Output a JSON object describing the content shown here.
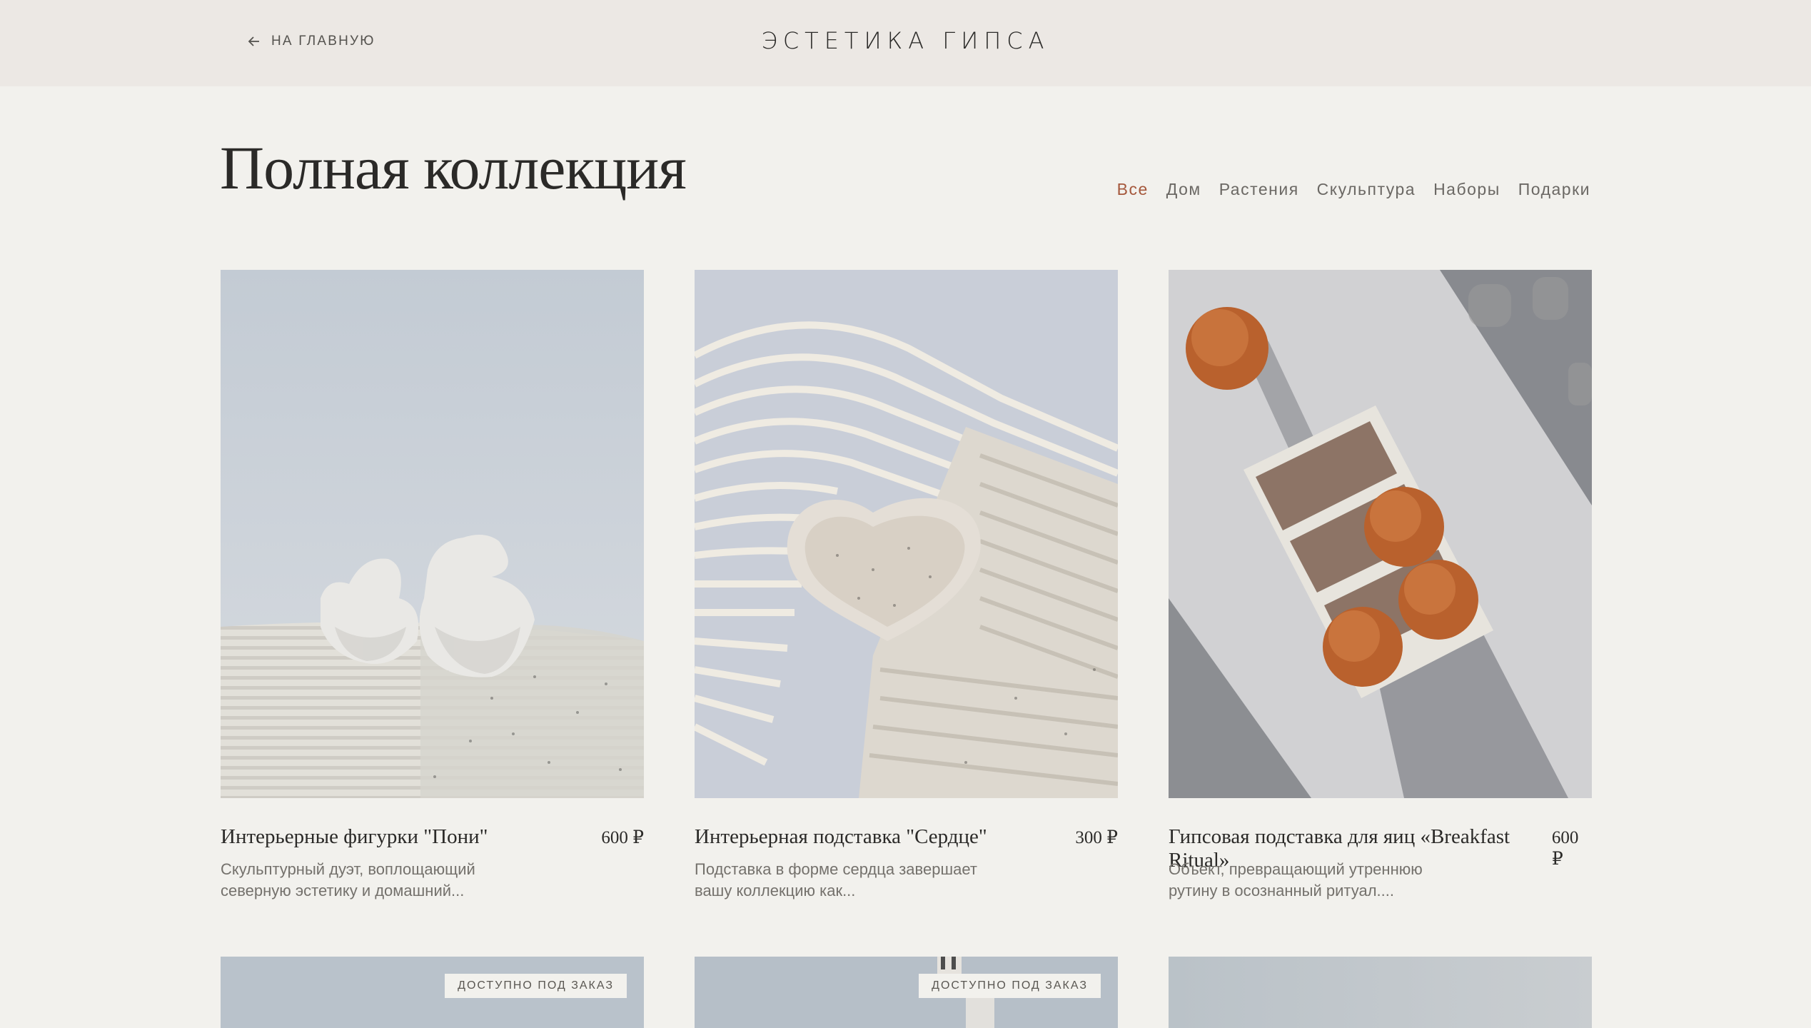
{
  "header": {
    "back_label": "НА ГЛАВНУЮ",
    "brand": "ЭСТЕТИКА ГИПСА"
  },
  "page": {
    "title": "Полная коллекция"
  },
  "filters": [
    "Все",
    "Дом",
    "Растения",
    "Скульптура",
    "Наборы",
    "Подарки"
  ],
  "active_filter": "Все",
  "products": [
    {
      "title": "Интерьерные фигурки \"Пони\"",
      "price": "600 ₽",
      "desc": "Скульптурный дуэт, воплощающий северную эстетику и домашний..."
    },
    {
      "title": "Интерьерная подставка \"Сердце\"",
      "price": "300 ₽",
      "desc": "Подставка в форме сердца завершает вашу коллекцию как..."
    },
    {
      "title": "Гипсовая подставка для яиц «Breakfast Ritual»",
      "price": "600 ₽",
      "desc": "Объект, превращающий утреннюю рутину в осознанный ритуал...."
    }
  ],
  "badges": {
    "order": "ДОСТУПНО ПОД ЗАКАЗ"
  },
  "colors": {
    "accent": "#a5583c",
    "background": "#f2f1ed",
    "header_bg": "#ece8e4"
  },
  "icons": {
    "back": "arrow-left-icon"
  }
}
